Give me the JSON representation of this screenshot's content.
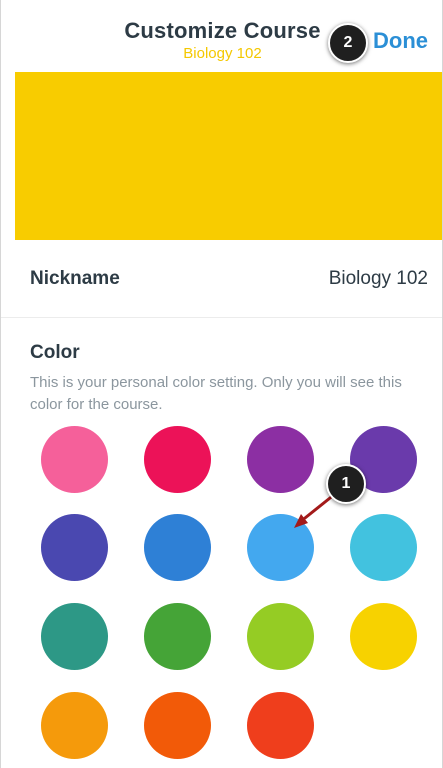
{
  "header": {
    "title": "Customize Course",
    "subtitle": "Biology 102",
    "done_label": "Done"
  },
  "banner": {
    "color": "#f8cc00"
  },
  "nickname": {
    "label": "Nickname",
    "value": "Biology 102"
  },
  "color_section": {
    "heading": "Color",
    "description": "This is your personal color setting. Only you will see this color for the course."
  },
  "annotations": {
    "step1": "1",
    "step2": "2"
  },
  "swatches": [
    {
      "color": "#f5609a"
    },
    {
      "color": "#ec1258"
    },
    {
      "color": "#8c2fa3"
    },
    {
      "color": "#6a3aab"
    },
    {
      "color": "#4a48b0"
    },
    {
      "color": "#2e80d6"
    },
    {
      "color": "#43a8ef"
    },
    {
      "color": "#42c2df"
    },
    {
      "color": "#2d9886"
    },
    {
      "color": "#45a437"
    },
    {
      "color": "#95cc24"
    },
    {
      "color": "#f7d200"
    },
    {
      "color": "#f59a0b"
    },
    {
      "color": "#f25a08"
    },
    {
      "color": "#ef3e1c"
    }
  ]
}
